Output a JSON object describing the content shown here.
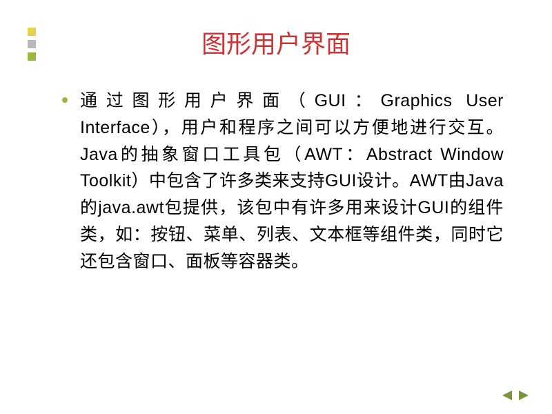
{
  "slide": {
    "title": "图形用户界面",
    "body": "通过图形用户界面（GUI：Graphics User Interface），用户和程序之间可以方便地进行交互。Java的抽象窗口工具包（AWT：Abstract Window Toolkit）中包含了许多类来支持GUI设计。AWT由Java的java.awt包提供，该包中有许多用来设计GUI的组件类，如：按钮、菜单、列表、文本框等组件类，同时它还包含窗口、面板等容器类。"
  },
  "colors": {
    "title": "#cc3333",
    "bullet": "#9ab83e",
    "nav": "#7a9636"
  },
  "nav": {
    "prev": "previous-slide",
    "next": "next-slide"
  }
}
